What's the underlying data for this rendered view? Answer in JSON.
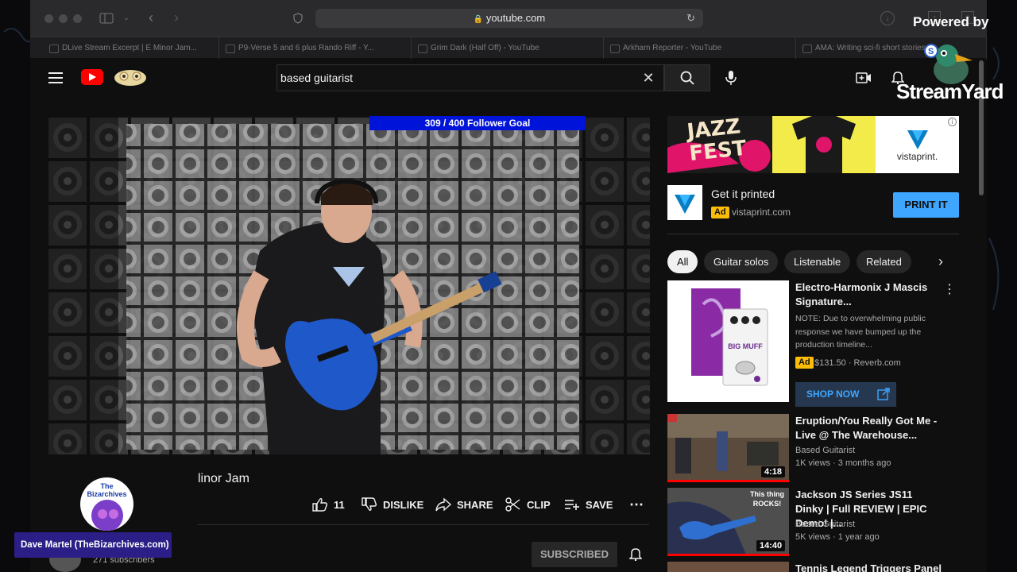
{
  "browser": {
    "url": "youtube.com",
    "tabs": [
      "DLive Stream Excerpt | E Minor Jam...",
      "P9-Verse 5 and 6 plus Rando Riff - Y...",
      "Grim Dark (Half Off) - YouTube",
      "Arkham Reporter - YouTube",
      "AMA: Writing sci-fi short stories..."
    ]
  },
  "masthead": {
    "search_value": "based guitarist",
    "search_placeholder": "Search"
  },
  "overlay": {
    "powered_by": "Powered by",
    "brand": "StreamYard",
    "follower_goal": "309 / 400 Follower Goal",
    "host_name": "Dave Martel (TheBizarchives.com)",
    "avatar_text": "The Bizarchives"
  },
  "video": {
    "title_fragment": "linor Jam",
    "likes": "11",
    "dislike_label": "DISLIKE",
    "share_label": "SHARE",
    "clip_label": "CLIP",
    "save_label": "SAVE",
    "subscribers": "271 subscribers",
    "subscribed_label": "SUBSCRIBED"
  },
  "ad": {
    "banner_text": "JAZZ FEST",
    "brand_logo": "vistaprint.",
    "title": "Get it printed",
    "badge": "Ad",
    "domain": "vistaprint.com",
    "cta": "PRINT IT"
  },
  "chips": [
    "All",
    "Guitar solos",
    "Listenable",
    "Related"
  ],
  "recommendations": [
    {
      "title": "Electro-Harmonix J Mascis Signature...",
      "description": "NOTE: Due to overwhelming public response we have bumped up the production timeline...",
      "badge": "Ad",
      "price": "$131.50 · Reverb.com",
      "cta": "SHOP NOW",
      "thumb_text": "BIG MUFF"
    },
    {
      "title": "Eruption/You Really Got Me - Live @ The Warehouse...",
      "channel": "Based Guitarist",
      "meta": "1K views · 3 months ago",
      "duration": "4:18"
    },
    {
      "title": "Jackson JS Series JS11 Dinky | Full REVIEW | EPIC Demo! |...",
      "channel": "Based Guitarist",
      "meta": "5K views · 1 year ago",
      "duration": "14:40",
      "thumb_text": "This thing ROCKS!"
    },
    {
      "title": "Tennis Legend Triggers Panel"
    }
  ],
  "colors": {
    "yt_red": "#ff0000",
    "accent_blue": "#3ea6ff",
    "ad_yellow": "#fbbd08",
    "goal_blue": "#0013d8"
  }
}
